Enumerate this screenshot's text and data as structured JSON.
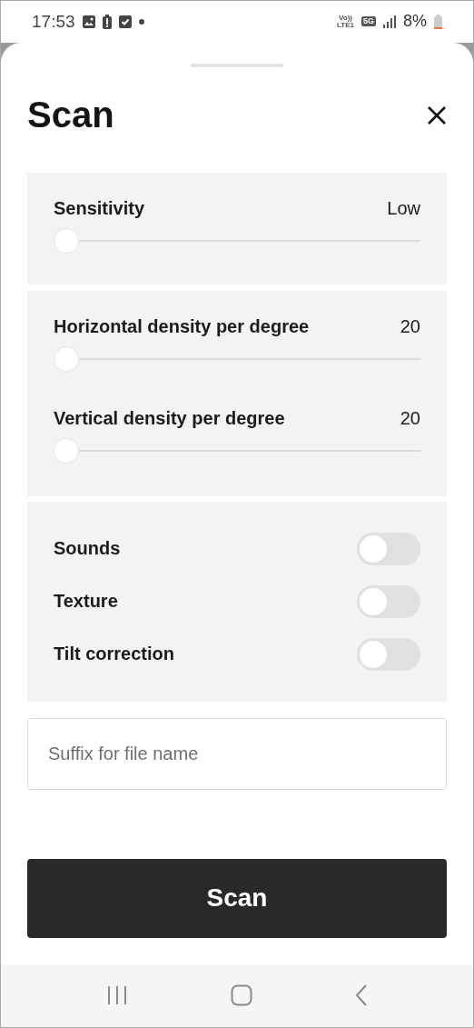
{
  "status_bar": {
    "time": "17:53",
    "network_labels": [
      "Vo))",
      "LTE1"
    ],
    "network_type": "5G",
    "battery": "8%"
  },
  "sheet": {
    "title": "Scan"
  },
  "slider_groups": [
    [
      {
        "label": "Sensitivity",
        "value": "Low",
        "level": 0
      }
    ],
    [
      {
        "label": "Horizontal density per degree",
        "value": "20",
        "level": 0
      },
      {
        "label": "Vertical density per degree",
        "value": "20",
        "level": 0
      }
    ]
  ],
  "toggles": [
    {
      "label": "Sounds",
      "on": false
    },
    {
      "label": "Texture",
      "on": false
    },
    {
      "label": "Tilt correction",
      "on": false
    }
  ],
  "suffix_field": {
    "placeholder": "Suffix for file name"
  },
  "scan_button": {
    "label": "Scan"
  }
}
